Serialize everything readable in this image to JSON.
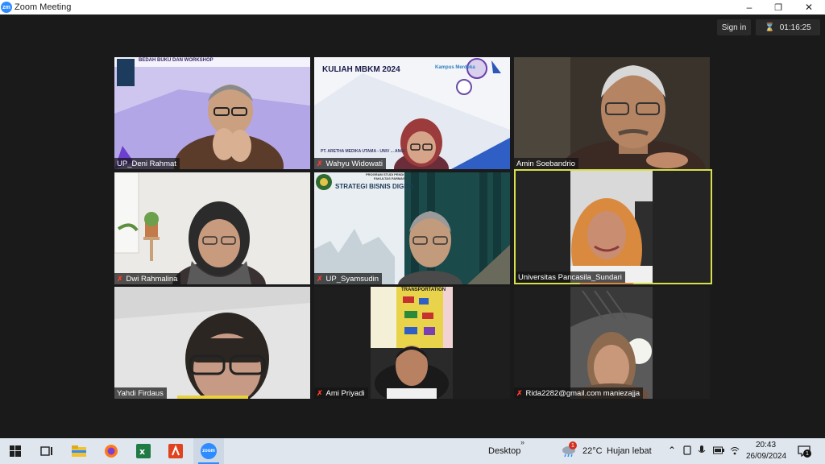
{
  "window": {
    "app_icon_text": "zm",
    "title": "Zoom Meeting",
    "sign_in": "Sign in",
    "elapsed": "01:16:25"
  },
  "tiles": [
    {
      "name": "UP_Deni Rahmat",
      "muted": false,
      "slide_title": "BEDAH BUKU DAN WORKSHOP"
    },
    {
      "name": "Wahyu Widowati",
      "muted": true,
      "slide_title": "KULIAH MBKM 2024",
      "slide_logo": "Kampus Merdeka",
      "slide_caption": "PT. ARETHA MEDIKA UTAMA - UNIV ... ANGI"
    },
    {
      "name": "Amin Soebandrio",
      "muted": false
    },
    {
      "name": "Dwi Rahmalina",
      "muted": true
    },
    {
      "name": "UP_Syamsudin",
      "muted": true,
      "slide_title": "STRATEGI BISNIS DIGITA",
      "slide_sub1": "PROGRAM STUDI PENDI",
      "slide_sub2": "FAKULTAS FARMASI"
    },
    {
      "name": "Universitas Pancasila_Sundari",
      "muted": false
    },
    {
      "name": "Yahdi Firdaus",
      "muted": false
    },
    {
      "name": "Ami Priyadi",
      "muted": true,
      "poster_title": "TRANSPORTATION"
    },
    {
      "name": "Rida2282@gmail.com maniezajja",
      "muted": true
    }
  ],
  "taskbar": {
    "zoom_label": "zoom",
    "desktop": "Desktop",
    "weather_temp": "22°C",
    "weather_desc": "Hujan lebat",
    "weather_badge": "1",
    "time": "20:43",
    "date": "26/09/2024",
    "notif_count": "1"
  },
  "colors": {
    "active_speaker": "#d7e04a",
    "muted": "#ff3b30",
    "zoom_blue": "#2d8cff"
  }
}
